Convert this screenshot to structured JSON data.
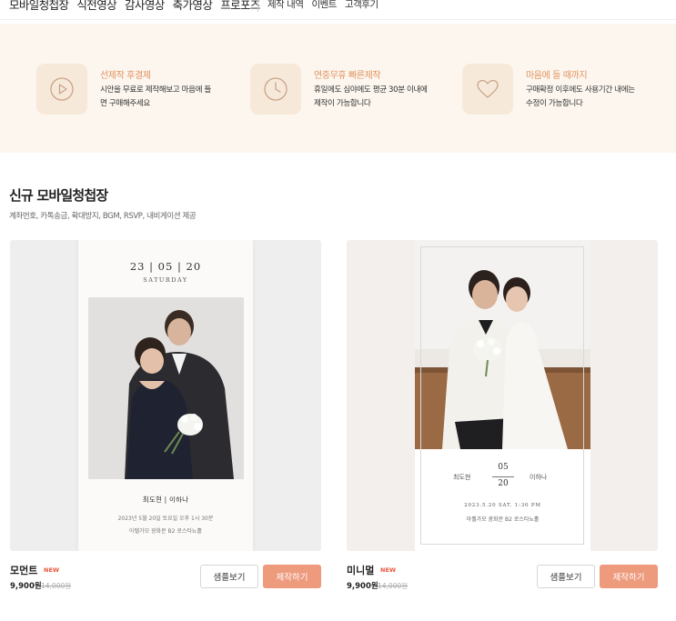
{
  "nav": {
    "main_items": [
      "모바일청첩장",
      "식전영상",
      "감사영상",
      "축가영상",
      "프로포즈"
    ],
    "sub_items": [
      "제작 내역",
      "이벤트",
      "고객후기"
    ]
  },
  "features": [
    {
      "icon": "play-icon",
      "title": "선제작 후결제",
      "desc": "시안을 무료로 제작해보고 마음에 들면 구매해주세요"
    },
    {
      "icon": "clock-icon",
      "title": "연중무휴 빠른제작",
      "desc": "휴일에도 심야에도 평균 30분 이내에 제작이 가능합니다"
    },
    {
      "icon": "heart-icon",
      "title": "마음에 들 때까지",
      "desc": "구매확정 이후에도 사용기간 내에는 수정이 가능합니다"
    }
  ],
  "section": {
    "title": "신규 모바일청첩장",
    "subtitle": "계좌번호, 카톡송금, 확대방지, BGM, RSVP, 내비게이션 제공"
  },
  "products": [
    {
      "name": "모먼트",
      "badge": "NEW",
      "price": "9,900원",
      "original_price": "14,000원",
      "sample_label": "샘플보기",
      "make_label": "제작하기",
      "preview": {
        "date": "23 | 05 | 20",
        "day": "SATURDAY",
        "names": "최도현   |   이하나",
        "when": "2023년 5월 20일 토요일 오후 1시 30분",
        "where": "아펠가모 광화문 B2 로스타뇨홀"
      }
    },
    {
      "name": "미니멀",
      "badge": "NEW",
      "price": "9,900원",
      "original_price": "14,000원",
      "sample_label": "샘플보기",
      "make_label": "제작하기",
      "preview": {
        "groom": "최도현",
        "bride": "이하나",
        "month": "05",
        "day_num": "20",
        "when": "2023.5.20 SAT. 1:30 PM",
        "where": "아펠가모 광화문 B2 로스타뇨홀"
      }
    }
  ],
  "colors": {
    "accent": "#ed9a7d",
    "feature_bg": "#fcf6ef",
    "feature_title": "#e0935f",
    "new_badge": "#e8563a"
  }
}
